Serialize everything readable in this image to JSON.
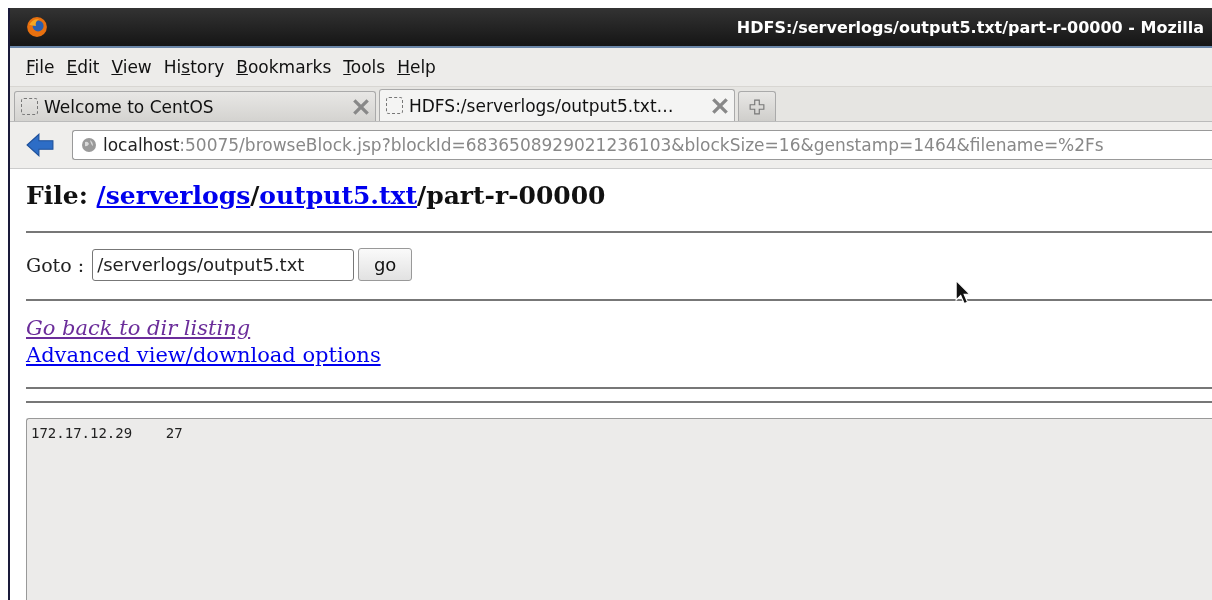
{
  "window": {
    "title": "HDFS:/serverlogs/output5.txt/part-r-00000 - Mozilla"
  },
  "menu": [
    {
      "access_key": "F",
      "label_rest": "ile"
    },
    {
      "access_key": "E",
      "label_rest": "dit"
    },
    {
      "access_key": "V",
      "label_rest": "iew"
    },
    {
      "label_start": "Hi",
      "access_key": "s",
      "label_rest": "tory"
    },
    {
      "access_key": "B",
      "label_rest": "ookmarks"
    },
    {
      "access_key": "T",
      "label_rest": "ools"
    },
    {
      "access_key": "H",
      "label_rest": "elp"
    }
  ],
  "tabs": [
    {
      "label": "Welcome to CentOS",
      "selected": false
    },
    {
      "label": "HDFS:/serverlogs/output5.txt…",
      "selected": true
    }
  ],
  "address_bar": {
    "host": "localhost",
    "rest": ":50075/browseBlock.jsp?blockId=6836508929021236103&blockSize=16&genstamp=1464&filename=%2Fs"
  },
  "page": {
    "heading_label": "File:",
    "path": [
      {
        "text": "/serverlogs",
        "link": true
      },
      {
        "text": "/",
        "link": false
      },
      {
        "text": "output5.txt",
        "link": true
      },
      {
        "text": "/part-r-00000",
        "link": false
      }
    ],
    "goto": {
      "label": "Goto :",
      "value": "/serverlogs/output5.txt",
      "button": "go"
    },
    "links": [
      {
        "text": "Go back to dir listing",
        "visited": true,
        "italic": true
      },
      {
        "text": "Advanced view/download options",
        "visited": false,
        "italic": false
      }
    ],
    "content": "172.17.12.29\t27"
  }
}
